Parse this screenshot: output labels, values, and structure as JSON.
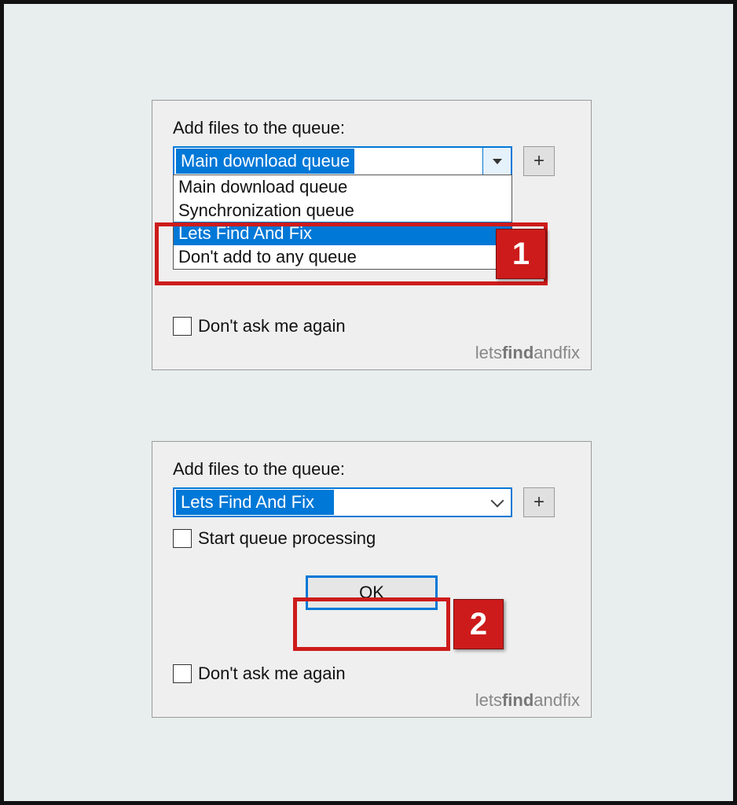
{
  "dialog1": {
    "label": "Add files to the queue:",
    "selected": "Main download queue",
    "options": [
      "Main download queue",
      "Synchronization queue",
      "Lets Find And Fix",
      "Don't add to any queue"
    ],
    "plus": "+",
    "dont_ask": "Don't ask me again"
  },
  "dialog2": {
    "label": "Add files to the queue:",
    "selected": "Lets Find And Fix",
    "start_queue": "Start queue processing",
    "plus": "+",
    "ok": "OK",
    "dont_ask": "Don't ask me again"
  },
  "watermark": {
    "a": "lets",
    "b": "find",
    "c": "and",
    "d": "fix"
  },
  "ann": {
    "one": "1",
    "two": "2"
  }
}
